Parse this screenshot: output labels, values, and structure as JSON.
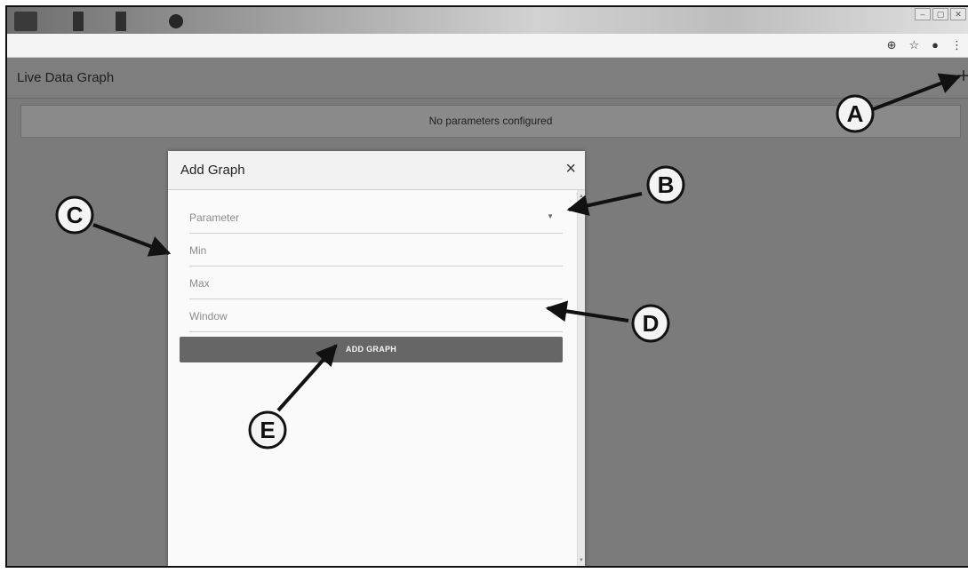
{
  "app": {
    "title": "Live Data Graph",
    "add_icon": "plus-icon",
    "add_glyph": "+",
    "status": "No parameters configured"
  },
  "browser": {
    "window_controls": [
      "–",
      "▢",
      "✕"
    ],
    "toolbar_icons": [
      {
        "name": "zoom-icon",
        "glyph": "⊕"
      },
      {
        "name": "star-icon",
        "glyph": "☆"
      },
      {
        "name": "account-icon",
        "glyph": "●"
      },
      {
        "name": "menu-icon",
        "glyph": "⋮"
      }
    ]
  },
  "dialog": {
    "title": "Add Graph",
    "close_glyph": "×",
    "fields": [
      {
        "name": "parameter-select",
        "label": "Parameter",
        "dropdown": true
      },
      {
        "name": "min-field",
        "label": "Min"
      },
      {
        "name": "max-field",
        "label": "Max"
      },
      {
        "name": "window-field",
        "label": "Window"
      }
    ],
    "submit_label": "ADD GRAPH"
  },
  "callouts": [
    "A",
    "B",
    "C",
    "D",
    "E"
  ]
}
